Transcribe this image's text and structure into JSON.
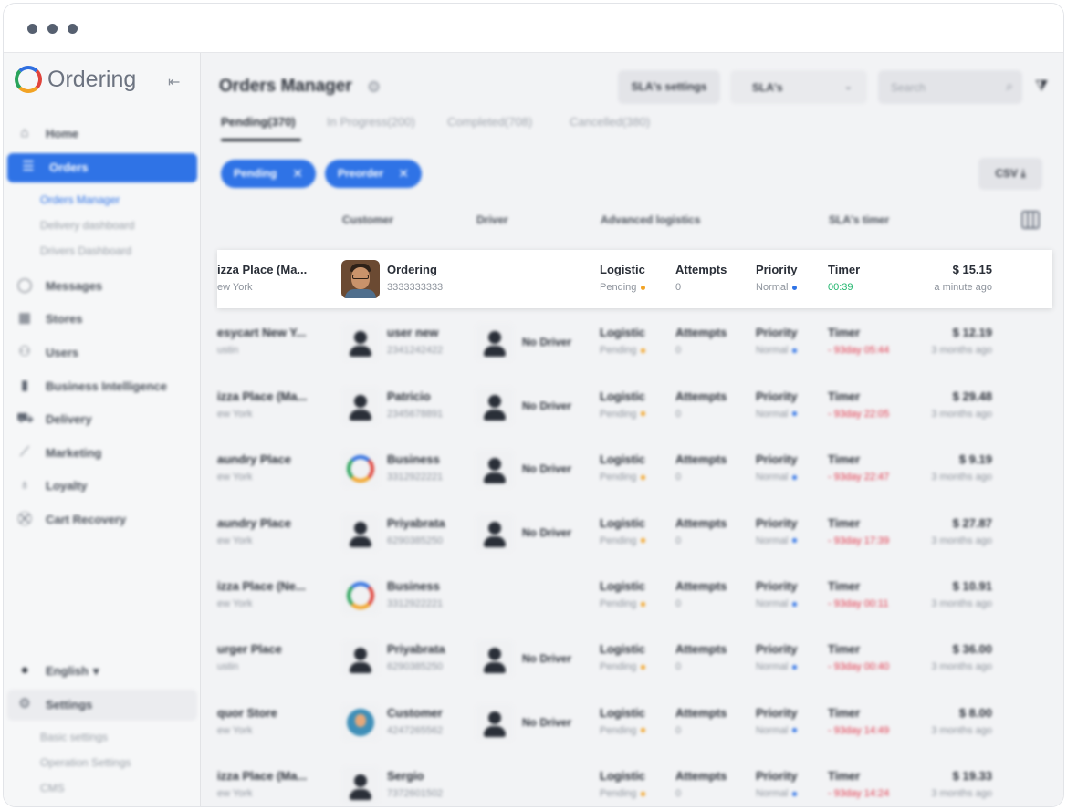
{
  "sidebar": {
    "logo_text": "Ordering",
    "nav": [
      {
        "label": "Home",
        "icon": "home-icon",
        "glyph": "⌂"
      },
      {
        "label": "Orders",
        "icon": "list-icon",
        "glyph": "☰"
      },
      {
        "label": "Messages",
        "icon": "chat-icon",
        "glyph": "◯"
      },
      {
        "label": "Stores",
        "icon": "store-icon",
        "glyph": "▦"
      },
      {
        "label": "Users",
        "icon": "users-icon",
        "glyph": "⚇"
      },
      {
        "label": "Business Intelligence",
        "icon": "bar-chart-icon",
        "glyph": "▮"
      },
      {
        "label": "Delivery",
        "icon": "truck-icon",
        "glyph": "⛟"
      },
      {
        "label": "Marketing",
        "icon": "trend-icon",
        "glyph": "⟋"
      },
      {
        "label": "Loyalty",
        "icon": "medal-icon",
        "glyph": "♁"
      },
      {
        "label": "Cart Recovery",
        "icon": "cart-icon",
        "glyph": "⛒"
      }
    ],
    "orders_sub": [
      "Orders Manager",
      "Delivery dashboard",
      "Drivers Dashboard"
    ],
    "language": {
      "label": "English",
      "arrow": "▾",
      "glyph": "●"
    },
    "settings": {
      "label": "Settings",
      "glyph": "⚙"
    },
    "settings_sub": [
      "Basic settings",
      "Operation Settings",
      "CMS"
    ]
  },
  "header": {
    "title": "Orders Manager",
    "sla_settings_button": "SLA's settings",
    "sla_select": "SLA's",
    "search_placeholder": "Search",
    "csv_button": "CSV ⤓"
  },
  "tabs": [
    "Pending(370)",
    "In Progress(200)",
    "Completed(708)",
    "Cancelled(380)"
  ],
  "chips": [
    {
      "label": "Pending"
    },
    {
      "label": "Preorder"
    }
  ],
  "table": {
    "headers": {
      "customer": "Customer",
      "driver": "Driver",
      "logistics": "Advanced logistics",
      "sla": "SLA's timer"
    },
    "rows": [
      {
        "business": "izza Place (Ma...",
        "city": "ew York",
        "customer": "Ordering",
        "phone": "3333333333",
        "avatar": "photo",
        "driver": "",
        "logistic": "Logistic",
        "logistic_status": "Pending",
        "attempts_label": "Attempts",
        "attempts": "0",
        "priority_label": "Priority",
        "priority": "Normal",
        "timer_label": "Timer",
        "timer": "00:39",
        "timer_state": "ok",
        "price": "$ 15.15",
        "ago": "a minute ago"
      },
      {
        "business": "esycart New Y...",
        "city": "ustin",
        "customer": "user new",
        "phone": "2341242422",
        "avatar": "user",
        "driver": "No Driver",
        "logistic": "Logistic",
        "logistic_status": "Pending",
        "attempts_label": "Attempts",
        "attempts": "0",
        "priority_label": "Priority",
        "priority": "Normal",
        "timer_label": "Timer",
        "timer": "- 93day 05:44",
        "timer_state": "late",
        "price": "$ 12.19",
        "ago": "3 months ago"
      },
      {
        "business": "izza Place (Ma...",
        "city": "ew York",
        "customer": "Patricio",
        "phone": "2345678891",
        "avatar": "user",
        "driver": "No Driver",
        "logistic": "Logistic",
        "logistic_status": "Pending",
        "attempts_label": "Attempts",
        "attempts": "0",
        "priority_label": "Priority",
        "priority": "Normal",
        "timer_label": "Timer",
        "timer": "- 93day 22:05",
        "timer_state": "late",
        "price": "$ 29.48",
        "ago": "3 months ago"
      },
      {
        "business": "aundry Place",
        "city": "ew York",
        "customer": "Business",
        "phone": "3312922221",
        "avatar": "biz",
        "driver": "No Driver",
        "logistic": "Logistic",
        "logistic_status": "Pending",
        "attempts_label": "Attempts",
        "attempts": "0",
        "priority_label": "Priority",
        "priority": "Normal",
        "timer_label": "Timer",
        "timer": "- 93day 22:47",
        "timer_state": "late",
        "price": "$ 9.19",
        "ago": "3 months ago"
      },
      {
        "business": "aundry Place",
        "city": "ew York",
        "customer": "Priyabrata",
        "phone": "6290385250",
        "avatar": "user",
        "driver": "No Driver",
        "logistic": "Logistic",
        "logistic_status": "Pending",
        "attempts_label": "Attempts",
        "attempts": "0",
        "priority_label": "Priority",
        "priority": "Normal",
        "timer_label": "Timer",
        "timer": "- 93day 17:39",
        "timer_state": "late",
        "price": "$ 27.87",
        "ago": "3 months ago"
      },
      {
        "business": "izza Place (Ne...",
        "city": "ew York",
        "customer": "Business",
        "phone": "3312922221",
        "avatar": "biz",
        "driver": "",
        "logistic": "Logistic",
        "logistic_status": "Pending",
        "attempts_label": "Attempts",
        "attempts": "0",
        "priority_label": "Priority",
        "priority": "Normal",
        "timer_label": "Timer",
        "timer": "- 93day 00:11",
        "timer_state": "late",
        "price": "$ 10.91",
        "ago": "3 months ago"
      },
      {
        "business": "urger Place",
        "city": "ustin",
        "customer": "Priyabrata",
        "phone": "6290385250",
        "avatar": "user",
        "driver": "No Driver",
        "logistic": "Logistic",
        "logistic_status": "Pending",
        "attempts_label": "Attempts",
        "attempts": "0",
        "priority_label": "Priority",
        "priority": "Normal",
        "timer_label": "Timer",
        "timer": "- 93day 00:40",
        "timer_state": "late",
        "price": "$ 36.00",
        "ago": "3 months ago"
      },
      {
        "business": "quor Store",
        "city": "ew York",
        "customer": "Customer",
        "phone": "4247265562",
        "avatar": "cust",
        "driver": "No Driver",
        "logistic": "Logistic",
        "logistic_status": "Pending",
        "attempts_label": "Attempts",
        "attempts": "0",
        "priority_label": "Priority",
        "priority": "Normal",
        "timer_label": "Timer",
        "timer": "- 93day 14:49",
        "timer_state": "late",
        "price": "$ 8.00",
        "ago": "3 months ago"
      },
      {
        "business": "izza Place (Ma...",
        "city": "ew York",
        "customer": "Sergio",
        "phone": "7372601502",
        "avatar": "user",
        "driver": "",
        "logistic": "Logistic",
        "logistic_status": "Pending",
        "attempts_label": "Attempts",
        "attempts": "0",
        "priority_label": "Priority",
        "priority": "Normal",
        "timer_label": "Timer",
        "timer": "- 93day 14:24",
        "timer_state": "late",
        "price": "$ 19.33",
        "ago": "3 months ago"
      }
    ]
  },
  "colors": {
    "accent": "#2f73e6",
    "timer_ok": "#1fb56c",
    "timer_late": "#e0364a",
    "pending_dot": "#f2a324"
  }
}
